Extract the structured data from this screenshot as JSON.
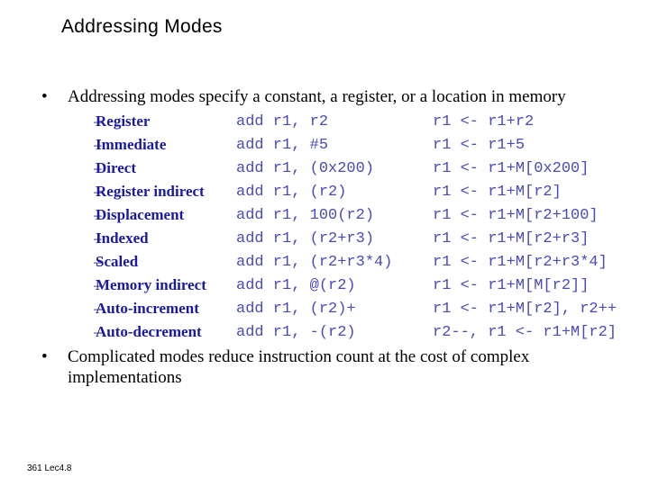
{
  "slide": {
    "title": "Addressing Modes",
    "footer": "361 Lec4.8",
    "bullets": [
      {
        "marker": "•",
        "lines": [
          "Addressing modes specify a constant, a register, or a location in memory"
        ]
      },
      {
        "marker": "•",
        "lines": [
          "Complicated modes reduce instruction count at the cost of complex",
          "implementations"
        ]
      }
    ],
    "sub_marker": "–",
    "modes": [
      {
        "name": "Register",
        "asm": "add r1, r2",
        "semantics": "r1 <- r1+r2"
      },
      {
        "name": "Immediate",
        "asm": "add r1, #5",
        "semantics": "r1 <- r1+5"
      },
      {
        "name": "Direct",
        "asm": "add r1, (0x200)",
        "semantics": "r1 <- r1+M[0x200]"
      },
      {
        "name": "Register indirect",
        "asm": "add r1, (r2)",
        "semantics": "r1 <- r1+M[r2]"
      },
      {
        "name": "Displacement",
        "asm": "add r1, 100(r2)",
        "semantics": "r1 <- r1+M[r2+100]"
      },
      {
        "name": "Indexed",
        "asm": "add r1, (r2+r3)",
        "semantics": "r1 <- r1+M[r2+r3]"
      },
      {
        "name": "Scaled",
        "asm": "add r1, (r2+r3*4)",
        "semantics": "r1 <- r1+M[r2+r3*4]"
      },
      {
        "name": "Memory indirect",
        "asm": "add r1, @(r2)",
        "semantics": "r1 <- r1+M[M[r2]]"
      },
      {
        "name": "Auto-increment",
        "asm": "add r1, (r2)+",
        "semantics": "r1 <- r1+M[r2], r2++"
      },
      {
        "name": "Auto-decrement",
        "asm": "add r1, -(r2)",
        "semantics": "r2--, r1 <- r1+M[r2]"
      }
    ],
    "colors": {
      "mode_name": "#1a1aa0",
      "code": "#4a4ab8",
      "text": "#000000"
    }
  }
}
